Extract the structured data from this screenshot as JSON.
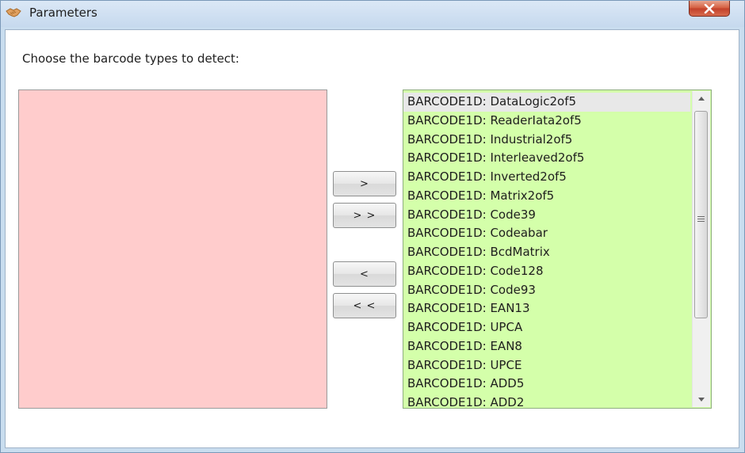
{
  "window": {
    "title": "Parameters",
    "app_icon": "handshake-icon",
    "close_icon": "close-icon"
  },
  "dialog": {
    "instruction": "Choose the barcode types to detect:"
  },
  "buttons": {
    "add": ">",
    "add_all": "> >",
    "remove": "<",
    "remove_all": "< <"
  },
  "available_list": {
    "items": [
      "BARCODE1D: DataLogic2of5",
      "BARCODE1D: ReaderIata2of5",
      "BARCODE1D: Industrial2of5",
      "BARCODE1D: Interleaved2of5",
      "BARCODE1D: Inverted2of5",
      "BARCODE1D: Matrix2of5",
      "BARCODE1D: Code39",
      "BARCODE1D: Codeabar",
      "BARCODE1D: BcdMatrix",
      "BARCODE1D: Code128",
      "BARCODE1D: Code93",
      "BARCODE1D: EAN13",
      "BARCODE1D: UPCA",
      "BARCODE1D: EAN8",
      "BARCODE1D: UPCE",
      "BARCODE1D: ADD5",
      "BARCODE1D: ADD2"
    ],
    "selected_index": 0
  },
  "colors": {
    "selected_list_bg": "#ffcccc",
    "available_list_bg": "#d4ffaa",
    "selection_highlight": "#e8e8e8"
  }
}
